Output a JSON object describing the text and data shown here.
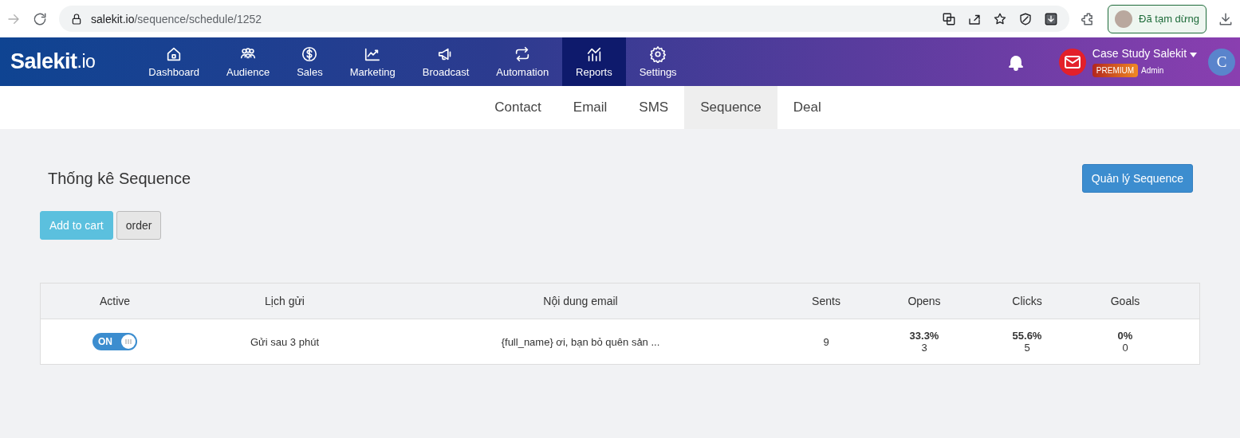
{
  "browser": {
    "url_host": "salekit.io",
    "url_path": "/sequence/schedule/1252",
    "profile_status": "Đã tạm dừng"
  },
  "nav": {
    "logo_main": "Salekit",
    "logo_suffix": ".io",
    "items": [
      {
        "label": "Dashboard",
        "selected": false
      },
      {
        "label": "Audience",
        "selected": false
      },
      {
        "label": "Sales",
        "selected": false
      },
      {
        "label": "Marketing",
        "selected": false
      },
      {
        "label": "Broadcast",
        "selected": false
      },
      {
        "label": "Automation",
        "selected": false
      },
      {
        "label": "Reports",
        "selected": true
      },
      {
        "label": "Settings",
        "selected": false
      }
    ],
    "account": {
      "name": "Case Study Salekit",
      "badge": "PREMIUM",
      "role": "Admin",
      "avatar": "C"
    }
  },
  "subtabs": [
    {
      "label": "Contact",
      "selected": false
    },
    {
      "label": "Email",
      "selected": false
    },
    {
      "label": "SMS",
      "selected": false
    },
    {
      "label": "Sequence",
      "selected": true
    },
    {
      "label": "Deal",
      "selected": false
    }
  ],
  "page": {
    "title": "Thống kê Sequence",
    "manage_button": "Quản lý Sequence",
    "buttons": [
      {
        "label": "Add to cart",
        "kind": "primary"
      },
      {
        "label": "order",
        "kind": "default"
      }
    ]
  },
  "table": {
    "columns": [
      "Active",
      "Lịch gửi",
      "Nội dung email",
      "Sents",
      "Opens",
      "Clicks",
      "Goals"
    ],
    "rows": [
      {
        "active": {
          "label": "ON",
          "on": true
        },
        "schedule": "Gửi sau 3 phút",
        "content": "{full_name} ơi, bạn bỏ quên sản ...",
        "sents": "9",
        "opens": {
          "rate": "33.3%",
          "count": "3"
        },
        "clicks": {
          "rate": "55.6%",
          "count": "5"
        },
        "goals": {
          "rate": "0%",
          "count": "0"
        }
      }
    ]
  }
}
